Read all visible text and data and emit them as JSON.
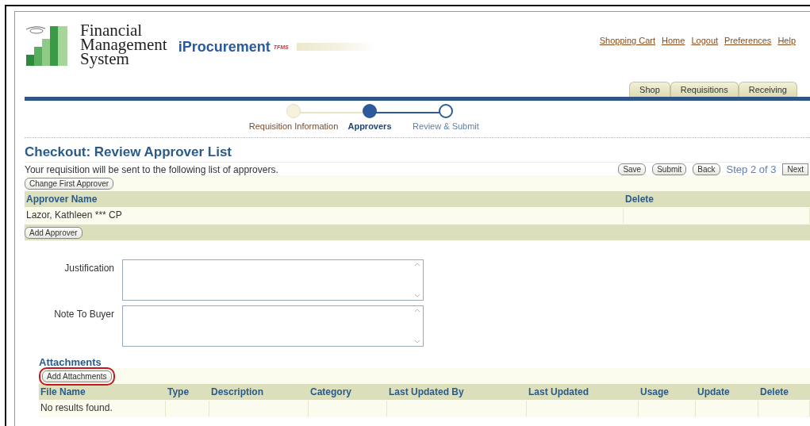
{
  "logo": {
    "lines": [
      "Financial",
      "Management",
      "System"
    ]
  },
  "product": {
    "name": "iProcurement",
    "tag": "TFMS"
  },
  "global_links": [
    "Shopping Cart",
    "Home",
    "Logout",
    "Preferences",
    "Help"
  ],
  "tabs": [
    {
      "label": "Shop",
      "selected": false
    },
    {
      "label": "Requisitions",
      "selected": false
    },
    {
      "label": "Receiving",
      "selected": false
    }
  ],
  "train": [
    {
      "label": "Requisition Information",
      "kind": "done"
    },
    {
      "label": "Approvers",
      "kind": "current"
    },
    {
      "label": "Review & Submit",
      "kind": "todo"
    }
  ],
  "heading": "Checkout: Review Approver List",
  "description": "Your requisition will be sent to the following list of approvers.",
  "actions": {
    "buttons": [
      "Save",
      "Submit",
      "Back"
    ],
    "step": "Step 2 of 3",
    "next": "Next"
  },
  "approvers": {
    "top_button": "Change First Approver",
    "columns": [
      "Approver Name",
      "Delete"
    ],
    "rows": [
      [
        "Lazor, Kathleen *** CP",
        ""
      ]
    ],
    "bottom_button": "Add Approver"
  },
  "fields": [
    {
      "label": "Justification"
    },
    {
      "label": "Note To Buyer"
    }
  ],
  "attachments": {
    "title": "Attachments",
    "button": {
      "label": "Add Attachments",
      "highlighted": true
    },
    "columns": [
      "File Name",
      "Type",
      "Description",
      "Category",
      "Last Updated By",
      "Last Updated",
      "Usage",
      "Update",
      "Delete"
    ],
    "empty": "No results found."
  }
}
